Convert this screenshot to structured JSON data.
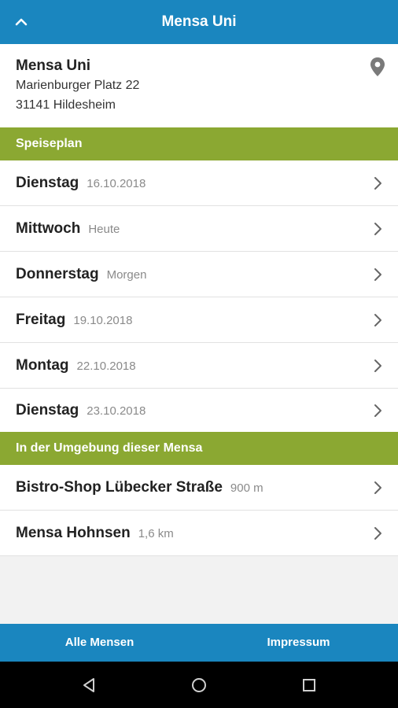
{
  "app_bar": {
    "title": "Mensa Uni",
    "up_icon": "chevron-up-icon"
  },
  "mensa": {
    "name": "Mensa Uni",
    "street": "Marienburger Platz 22",
    "city": "31141 Hildesheim",
    "location_icon": "map-pin-icon"
  },
  "speiseplan": {
    "heading": "Speiseplan",
    "days": [
      {
        "day": "Dienstag",
        "date": "16.10.2018"
      },
      {
        "day": "Mittwoch",
        "date": "Heute"
      },
      {
        "day": "Donnerstag",
        "date": "Morgen"
      },
      {
        "day": "Freitag",
        "date": "19.10.2018"
      },
      {
        "day": "Montag",
        "date": "22.10.2018"
      },
      {
        "day": "Dienstag",
        "date": "23.10.2018"
      }
    ]
  },
  "nearby": {
    "heading": "In der Umgebung dieser Mensa",
    "places": [
      {
        "name": "Bistro-Shop Lübecker Straße",
        "distance": "900 m"
      },
      {
        "name": "Mensa Hohnsen",
        "distance": "1,6 km"
      }
    ]
  },
  "bottom_bar": {
    "all_label": "Alle Mensen",
    "impressum_label": "Impressum"
  },
  "colors": {
    "primary": "#1a86bf",
    "section_green": "#8ba832",
    "background": "#f2f2f2"
  }
}
